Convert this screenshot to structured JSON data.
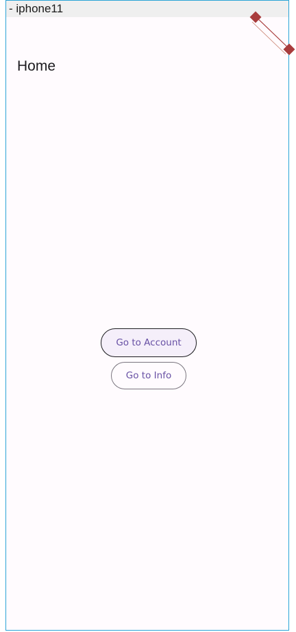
{
  "device": {
    "label": "- iphone11"
  },
  "page": {
    "title": "Home"
  },
  "buttons": {
    "account_label": "Go to Account",
    "info_label": "Go to Info"
  },
  "colors": {
    "frame_border": "#29a3d6",
    "background": "#fffbfe",
    "button_text": "#6750a4",
    "debug_banner": "#a83c3c"
  }
}
